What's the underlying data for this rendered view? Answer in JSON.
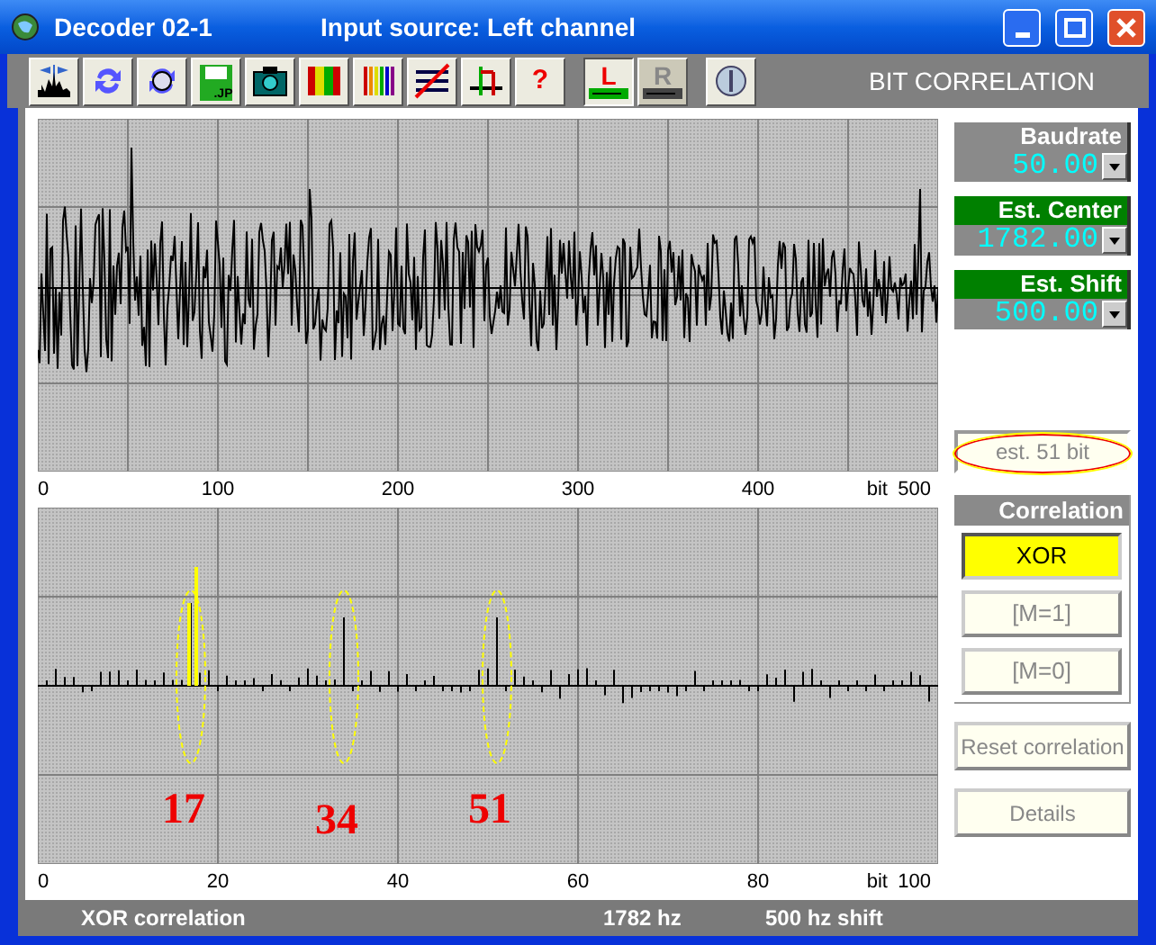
{
  "window": {
    "title": "Decoder 02-1",
    "subtitle": "Input source: Left channel"
  },
  "toolbar": {
    "buttons": [
      {
        "kind": "spectrum"
      },
      {
        "kind": "refresh"
      },
      {
        "kind": "refresh5"
      },
      {
        "kind": "save",
        "label": ".JP"
      },
      {
        "kind": "camera"
      },
      {
        "kind": "colorbars"
      },
      {
        "kind": "lines"
      },
      {
        "kind": "grid"
      },
      {
        "kind": "axes"
      },
      {
        "kind": "help",
        "label": "?"
      },
      {
        "kind": "channel",
        "label": "L",
        "selected": true
      },
      {
        "kind": "channel",
        "label": "R",
        "selected": false
      },
      {
        "kind": "power"
      }
    ],
    "panel_title": "BIT CORRELATION"
  },
  "signal_plot": {
    "axis_labels": [
      "0",
      "100",
      "200",
      "300",
      "400",
      "500"
    ],
    "unit": "bit"
  },
  "correlation_plot": {
    "axis_labels": [
      "0",
      "20",
      "40",
      "60",
      "80",
      "100"
    ],
    "unit": "bit",
    "markers": [
      {
        "label": "17"
      },
      {
        "label": "34"
      },
      {
        "label": "51"
      }
    ]
  },
  "fields": [
    {
      "label": "Baudrate",
      "value": "50.00",
      "highlighted": false
    },
    {
      "label": "Est. Center",
      "value": "1782.00",
      "highlighted": true
    },
    {
      "label": "Est. Shift",
      "value": "500.00",
      "highlighted": true
    }
  ],
  "estimate_button": {
    "label": "est. 51 bit",
    "circled": true
  },
  "correlation": {
    "title": "Correlation",
    "modes": [
      {
        "label": "XOR",
        "selected": true
      },
      {
        "label": "[M=1]",
        "selected": false
      },
      {
        "label": "[M=0]",
        "selected": false
      }
    ]
  },
  "actions": [
    "Reset correlation",
    "Details"
  ],
  "status_bar": [
    "XOR correlation",
    "1782 hz",
    "500 hz shift"
  ]
}
